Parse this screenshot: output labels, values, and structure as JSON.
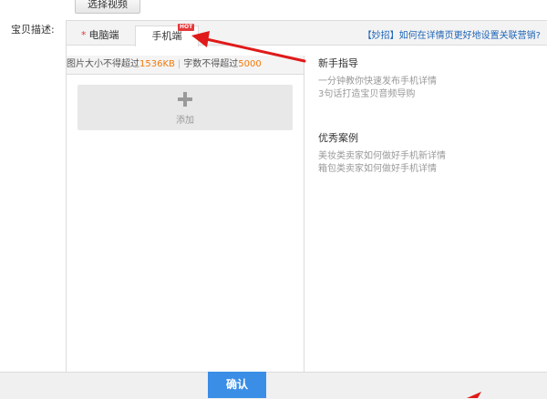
{
  "top": {
    "select_video_label": "选择视频"
  },
  "form": {
    "desc_label": "宝贝描述:"
  },
  "tabs": {
    "pc": {
      "star": "*",
      "label": "电脑端"
    },
    "mobile": {
      "label": "手机端",
      "badge": "HOT"
    }
  },
  "tip_link": "【妙招】如何在详情页更好地设置关联营销?",
  "limits": {
    "image_prefix": "图片大小不得超过",
    "image_value": "1536KB",
    "sep": "|",
    "text_prefix": "字数不得超过",
    "text_value": "5000"
  },
  "add_block": {
    "label": "添加",
    "icon": "plus-icon"
  },
  "guide": {
    "title": "新手指导",
    "lines": [
      "一分钟教你快速发布手机详情",
      "3句话打造宝贝音频导购"
    ]
  },
  "cases": {
    "title": "优秀案例",
    "lines": [
      "美妆类卖家如何做好手机新详情",
      "箱包类卖家如何做好手机详情"
    ]
  },
  "footer": {
    "confirm_label": "确认"
  },
  "colors": {
    "accent_blue": "#3a8ee6",
    "link_blue": "#1f65b7",
    "badge_red": "#e4393c",
    "limit_orange": "#f27a0a",
    "arrow_red": "#e01a1a"
  }
}
